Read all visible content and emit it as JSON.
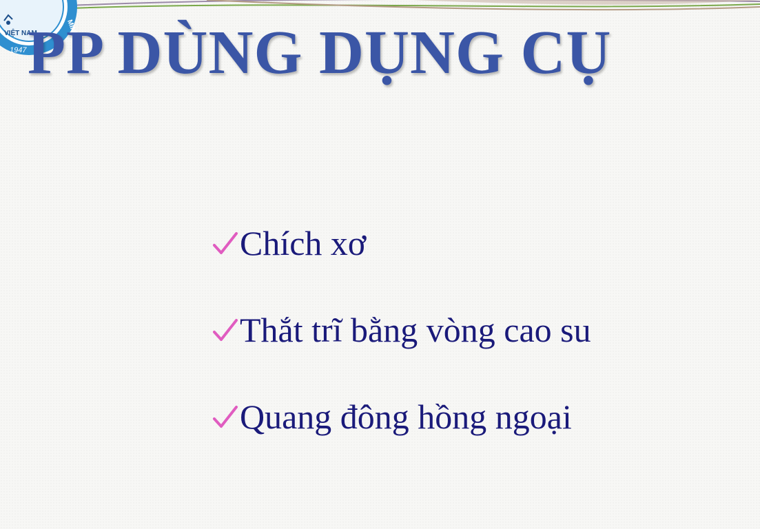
{
  "slide": {
    "title": "PP DÙNG DỤNG CỤ",
    "logo": {
      "text_top": "VIỆT NAM",
      "text_year": "1947",
      "text_side": "MINH"
    },
    "bullets": [
      {
        "icon": "check-icon",
        "label": "Chích xơ"
      },
      {
        "icon": "check-icon",
        "label": "Thắt trĩ bằng vòng cao su"
      },
      {
        "icon": "check-icon",
        "label": "Quang đông hồng ngoại"
      }
    ]
  },
  "colors": {
    "title": "#3b56a6",
    "bullet_text": "#1a1a7a",
    "check": "#e05cc0",
    "background": "#f7f7f5"
  }
}
